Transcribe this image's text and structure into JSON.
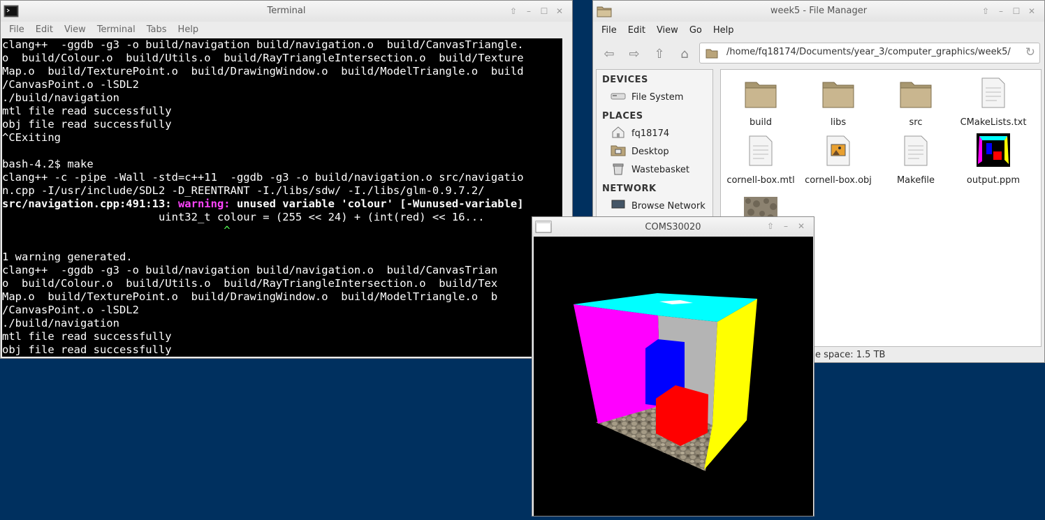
{
  "terminal": {
    "title": "Terminal",
    "menu": [
      "File",
      "Edit",
      "View",
      "Terminal",
      "Tabs",
      "Help"
    ],
    "lines": [
      "clang++  -ggdb -g3 -o build/navigation build/navigation.o  build/CanvasTriangle.",
      "o  build/Colour.o  build/Utils.o  build/RayTriangleIntersection.o  build/Texture",
      "Map.o  build/TexturePoint.o  build/DrawingWindow.o  build/ModelTriangle.o  build",
      "/CanvasPoint.o -lSDL2",
      "./build/navigation",
      "mtl file read successfully",
      "obj file read successfully",
      "^CExiting",
      "",
      "bash-4.2$ make",
      "clang++ -c -pipe -Wall -std=c++11  -ggdb -g3 -o build/navigation.o src/navigatio",
      "n.cpp -I/usr/include/SDL2 -D_REENTRANT -I./libs/sdw/ -I./libs/glm-0.9.7.2/"
    ],
    "warning": {
      "location": "src/navigation.cpp:491:13: ",
      "label": "warning: ",
      "message": "unused variable 'colour' [-Wunused-variable]",
      "source": "                        uint32_t colour = (255 << 24) + (int(red) << 16...",
      "caret": "                                  ^"
    },
    "lines2": [
      "",
      "1 warning generated.",
      "clang++  -ggdb -g3 -o build/navigation build/navigation.o  build/CanvasTrian",
      "o  build/Colour.o  build/Utils.o  build/RayTriangleIntersection.o  build/Tex",
      "Map.o  build/TexturePoint.o  build/DrawingWindow.o  build/ModelTriangle.o  b",
      "/CanvasPoint.o -lSDL2",
      "./build/navigation",
      "mtl file read successfully",
      "obj file read successfully"
    ]
  },
  "file_manager": {
    "title": "week5 - File Manager",
    "menu": [
      "File",
      "Edit",
      "View",
      "Go",
      "Help"
    ],
    "path": "/home/fq18174/Documents/year_3/computer_graphics/week5/",
    "sidebar": {
      "devices_header": "DEVICES",
      "devices": [
        {
          "label": "File System",
          "icon": "drive-icon"
        }
      ],
      "places_header": "PLACES",
      "places": [
        {
          "label": "fq18174",
          "icon": "home-icon"
        },
        {
          "label": "Desktop",
          "icon": "desktop-icon"
        },
        {
          "label": "Wastebasket",
          "icon": "trash-icon"
        }
      ],
      "network_header": "NETWORK",
      "network": [
        {
          "label": "Browse Network",
          "icon": "network-icon"
        }
      ]
    },
    "files": [
      {
        "name": "build",
        "type": "folder"
      },
      {
        "name": "libs",
        "type": "folder"
      },
      {
        "name": "src",
        "type": "folder"
      },
      {
        "name": "CMakeLists.txt",
        "type": "text"
      },
      {
        "name": "cornell-box.mtl",
        "type": "text"
      },
      {
        "name": "cornell-box.obj",
        "type": "image-doc"
      },
      {
        "name": "Makefile",
        "type": "text"
      },
      {
        "name": "output.ppm",
        "type": "image"
      }
    ],
    "status": "e space: 1.5 TB"
  },
  "render_window": {
    "title": "COMS30020"
  }
}
